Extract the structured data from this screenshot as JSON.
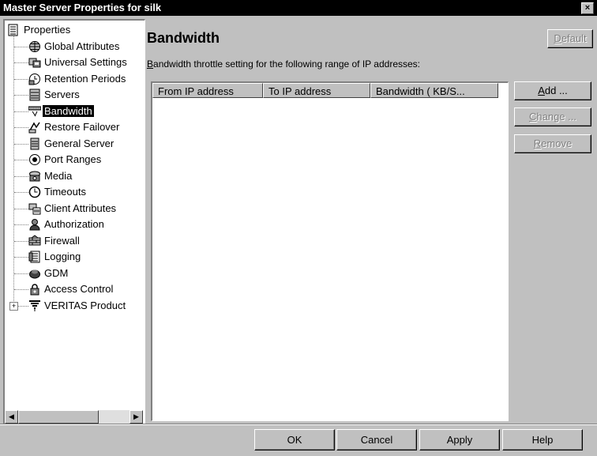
{
  "window": {
    "title": "Master Server Properties for silk",
    "close_glyph": "×"
  },
  "tree": {
    "root": "Properties",
    "items": [
      {
        "label": "Global Attributes",
        "icon": "globe-icon"
      },
      {
        "label": "Universal Settings",
        "icon": "universal-settings-icon"
      },
      {
        "label": "Retention Periods",
        "icon": "retention-icon"
      },
      {
        "label": "Servers",
        "icon": "server-icon"
      },
      {
        "label": "Bandwidth",
        "icon": "bandwidth-icon",
        "selected": true
      },
      {
        "label": "Restore Failover",
        "icon": "restore-failover-icon"
      },
      {
        "label": "General Server",
        "icon": "general-server-icon"
      },
      {
        "label": "Port Ranges",
        "icon": "port-ranges-icon"
      },
      {
        "label": "Media",
        "icon": "media-icon"
      },
      {
        "label": "Timeouts",
        "icon": "clock-icon"
      },
      {
        "label": "Client Attributes",
        "icon": "client-attributes-icon"
      },
      {
        "label": "Authorization",
        "icon": "person-icon"
      },
      {
        "label": "Firewall",
        "icon": "firewall-icon"
      },
      {
        "label": "Logging",
        "icon": "logging-icon"
      },
      {
        "label": "GDM",
        "icon": "gdm-icon"
      },
      {
        "label": "Access Control",
        "icon": "lock-icon"
      },
      {
        "label": "VERITAS Product",
        "icon": "veritas-icon",
        "expander": "+"
      }
    ]
  },
  "main": {
    "heading": "Bandwidth",
    "description_prefix": "B",
    "description_rest": "andwidth throttle setting for the following range of IP addresses:",
    "columns": [
      "From IP address",
      "To IP address",
      "Bandwidth ( KB/S..."
    ],
    "rows": []
  },
  "buttons": {
    "default": {
      "pre": "",
      "u": "D",
      "post": "efault",
      "enabled": false
    },
    "add": {
      "pre": "",
      "u": "A",
      "post": "dd ...",
      "enabled": true
    },
    "change": {
      "pre": "",
      "u": "C",
      "post": "hange ...",
      "enabled": false
    },
    "remove": {
      "pre": "",
      "u": "R",
      "post": "emove",
      "enabled": false
    },
    "ok": "OK",
    "cancel": "Cancel",
    "apply": "Apply",
    "help": "Help"
  },
  "scrollbar": {
    "left_arrow": "◀",
    "right_arrow": "▶"
  }
}
